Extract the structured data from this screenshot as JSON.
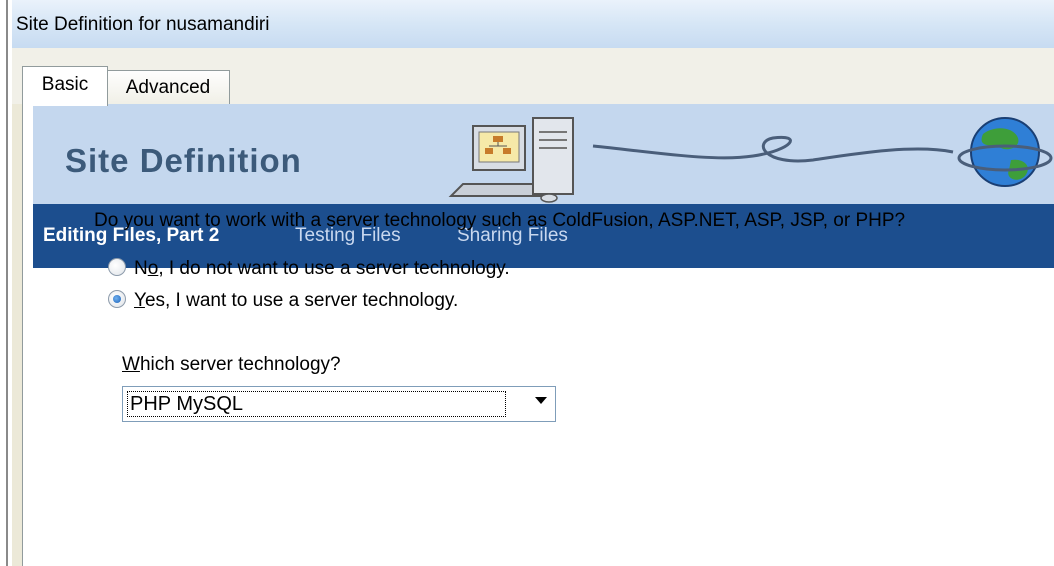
{
  "window": {
    "title": "Site Definition for nusamandiri"
  },
  "tabs": [
    {
      "label": "Basic"
    },
    {
      "label": "Advanced"
    }
  ],
  "banner": {
    "title": "Site Definition"
  },
  "nav": [
    {
      "label": "Editing Files, Part 2"
    },
    {
      "label": "Testing Files"
    },
    {
      "label": "Sharing Files"
    }
  ],
  "question": "Do you want to work with a server technology such as ColdFusion, ASP.NET, ASP, JSP, or PHP?",
  "options": {
    "no": {
      "accesskey": "o",
      "before": "N",
      "after": ", I do not want to use a server technology.",
      "checked": false
    },
    "yes": {
      "accesskey": "Y",
      "after": "es, I want to use a server technology.",
      "checked": true
    }
  },
  "server_tech": {
    "accesskey": "W",
    "label_rest": "hich server technology?",
    "selected": "PHP MySQL"
  },
  "colors": {
    "navbar": "#1c4e8e",
    "banner": "#c4d7ee",
    "banner_title": "#3c5a7a"
  }
}
